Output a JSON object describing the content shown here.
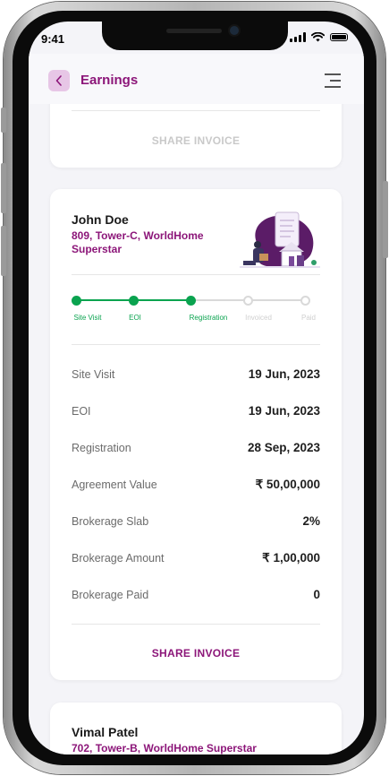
{
  "status": {
    "time": "9:41"
  },
  "header": {
    "title": "Earnings"
  },
  "top_card": {
    "share_label": "SHARE INVOICE"
  },
  "lead_card": {
    "name": "John Doe",
    "address_line1": "809, Tower-C, WorldHome",
    "address_line2": "Superstar",
    "progress": {
      "steps": [
        {
          "label": "Site Visit",
          "done": true
        },
        {
          "label": "EOI",
          "done": true
        },
        {
          "label": "Registration",
          "done": true
        },
        {
          "label": "Invoiced",
          "done": false
        },
        {
          "label": "Paid",
          "done": false
        }
      ],
      "active_color": "#0aa34f",
      "inactive_color": "#d9d9d9"
    },
    "rows": [
      {
        "label": "Site Visit",
        "value": "19 Jun, 2023"
      },
      {
        "label": "EOI",
        "value": "19 Jun, 2023"
      },
      {
        "label": "Registration",
        "value": "28 Sep, 2023"
      },
      {
        "label": "Agreement Value",
        "value": "₹ 50,00,000"
      },
      {
        "label": "Brokerage Slab",
        "value": "2%"
      },
      {
        "label": "Brokerage Amount",
        "value": "₹ 1,00,000"
      },
      {
        "label": "Brokerage Paid",
        "value": "0"
      }
    ],
    "share_label": "SHARE INVOICE"
  },
  "next_card": {
    "name": "Vimal Patel",
    "address": "702, Tower-B, WorldHome Superstar"
  },
  "colors": {
    "brand": "#8c1679",
    "success": "#0aa34f",
    "muted_share": "#c9c9c9"
  }
}
